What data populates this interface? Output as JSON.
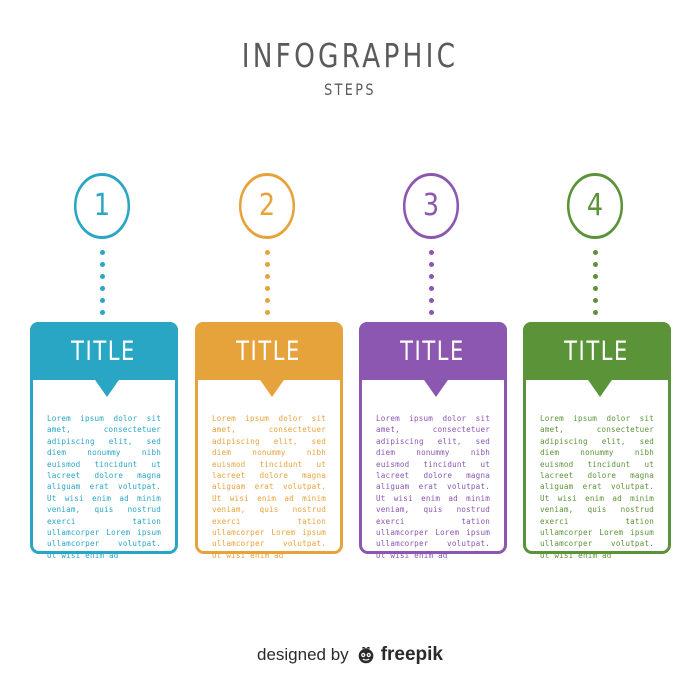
{
  "header": {
    "title": "INFOGRAPHIC",
    "subtitle": "STEPS"
  },
  "colors": {
    "step1": "#29a6c4",
    "step2": "#e7a33b",
    "step3": "#8b57b0",
    "step4": "#5b9338",
    "text": "#5a5a5a"
  },
  "steps": [
    {
      "number": "1",
      "title": "TITLE",
      "body": "Lorem ipsum dolor sit amet, consectetuer adipiscing elit, sed diem nonummy nibh euismod tincidunt ut lacreet dolore magna aliguam erat volutpat. Ut wisi enim ad minim veniam, quis nostrud exerci tation ullamcorper Lorem ipsum ullamcorper volutpat. Ut wisi enim ad"
    },
    {
      "number": "2",
      "title": "TITLE",
      "body": "Lorem ipsum dolor sit amet, consectetuer adipiscing elit, sed diem nonummy nibh euismod tincidunt ut lacreet dolore magna aliguam erat volutpat. Ut wisi enim ad minim veniam, quis nostrud exerci tation ullamcorper Lorem ipsum ullamcorper volutpat. Ut wisi enim ad"
    },
    {
      "number": "3",
      "title": "TITLE",
      "body": "Lorem ipsum dolor sit amet, consectetuer adipiscing elit, sed diem nonummy nibh euismod tincidunt ut lacreet dolore magna aliguam erat volutpat. Ut wisi enim ad minim veniam, quis nostrud exerci tation ullamcorper Lorem ipsum ullamcorper volutpat. Ut wisi enim ad"
    },
    {
      "number": "4",
      "title": "TITLE",
      "body": "Lorem ipsum dolor sit amet, consectetuer adipiscing elit, sed diem nonummy nibh euismod tincidunt ut lacreet dolore magna aliguam erat volutpat. Ut wisi enim ad minim veniam, quis nostrud exerci tation ullamcorper Lorem ipsum ullamcorper volutpat. Ut wisi enim ad"
    }
  ],
  "footer": {
    "designed_by": "designed by",
    "brand": "freepik",
    "brand_icon": "freepik-logo-icon"
  }
}
